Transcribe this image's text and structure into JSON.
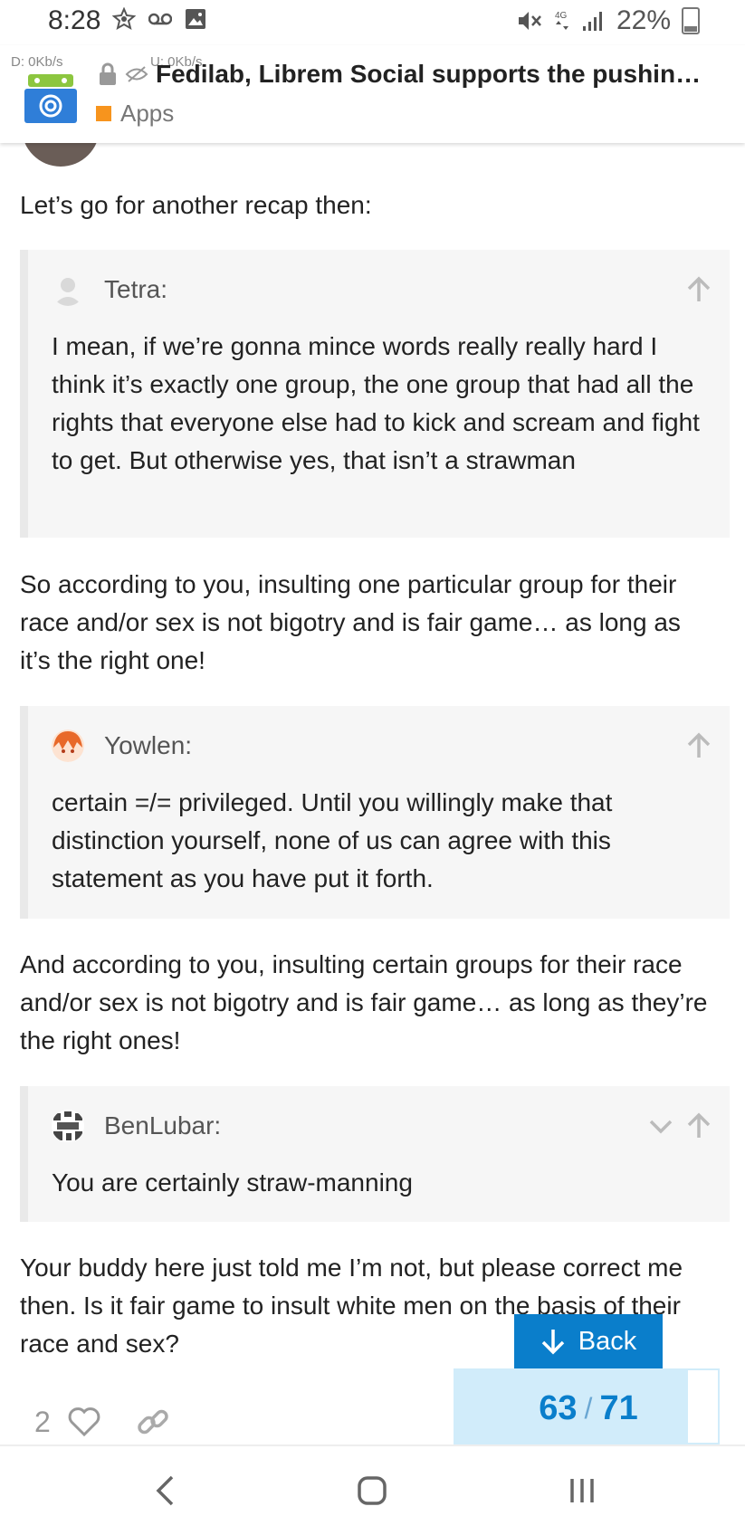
{
  "status_bar": {
    "time": "8:28",
    "battery": "22%",
    "download_speed": "D: 0Kb/s",
    "upload_speed": "U: 0Kb/s"
  },
  "header": {
    "title": "Fedilab, Librem Social supports the pushin…",
    "category": "Apps",
    "category_color": "#F7941D"
  },
  "posts": {
    "intro": "Let’s go for another recap then:",
    "quote1": {
      "username": "Tetra:",
      "body": "I mean, if we’re gonna mince words really really hard I think it’s exactly one group, the one group that had all the rights that everyone else had to kick and scream and fight to get. But otherwise yes, that isn’t a strawman"
    },
    "para2": "So according to you, insulting one particular group for their race and/or sex is not bigotry and is fair game… as long as it’s the right one!",
    "quote2": {
      "username": "Yowlen:",
      "body": "certain =/= privileged. Until you willingly make that distinction yourself, none of us can agree with this statement as you have put it forth."
    },
    "para3": "And according to you, insulting certain groups for their race and/or sex is not bigotry and is fair game… as long as they’re the right ones!",
    "quote3": {
      "username": "BenLubar:",
      "body": "You are certainly straw-manning"
    },
    "para4": "Your buddy here just told me I’m not, but please correct me then. Is it fair game to insult white men on the basis of their race and sex?"
  },
  "actions": {
    "like_count": "2"
  },
  "back_button": {
    "label": "Back"
  },
  "progress": {
    "current": "63",
    "separator": "/",
    "total": "71",
    "fraction": 0.887
  },
  "colors": {
    "accent": "#0a7ecb",
    "progress_bg": "#d1ecfa",
    "quote_bg": "#f6f6f6"
  }
}
